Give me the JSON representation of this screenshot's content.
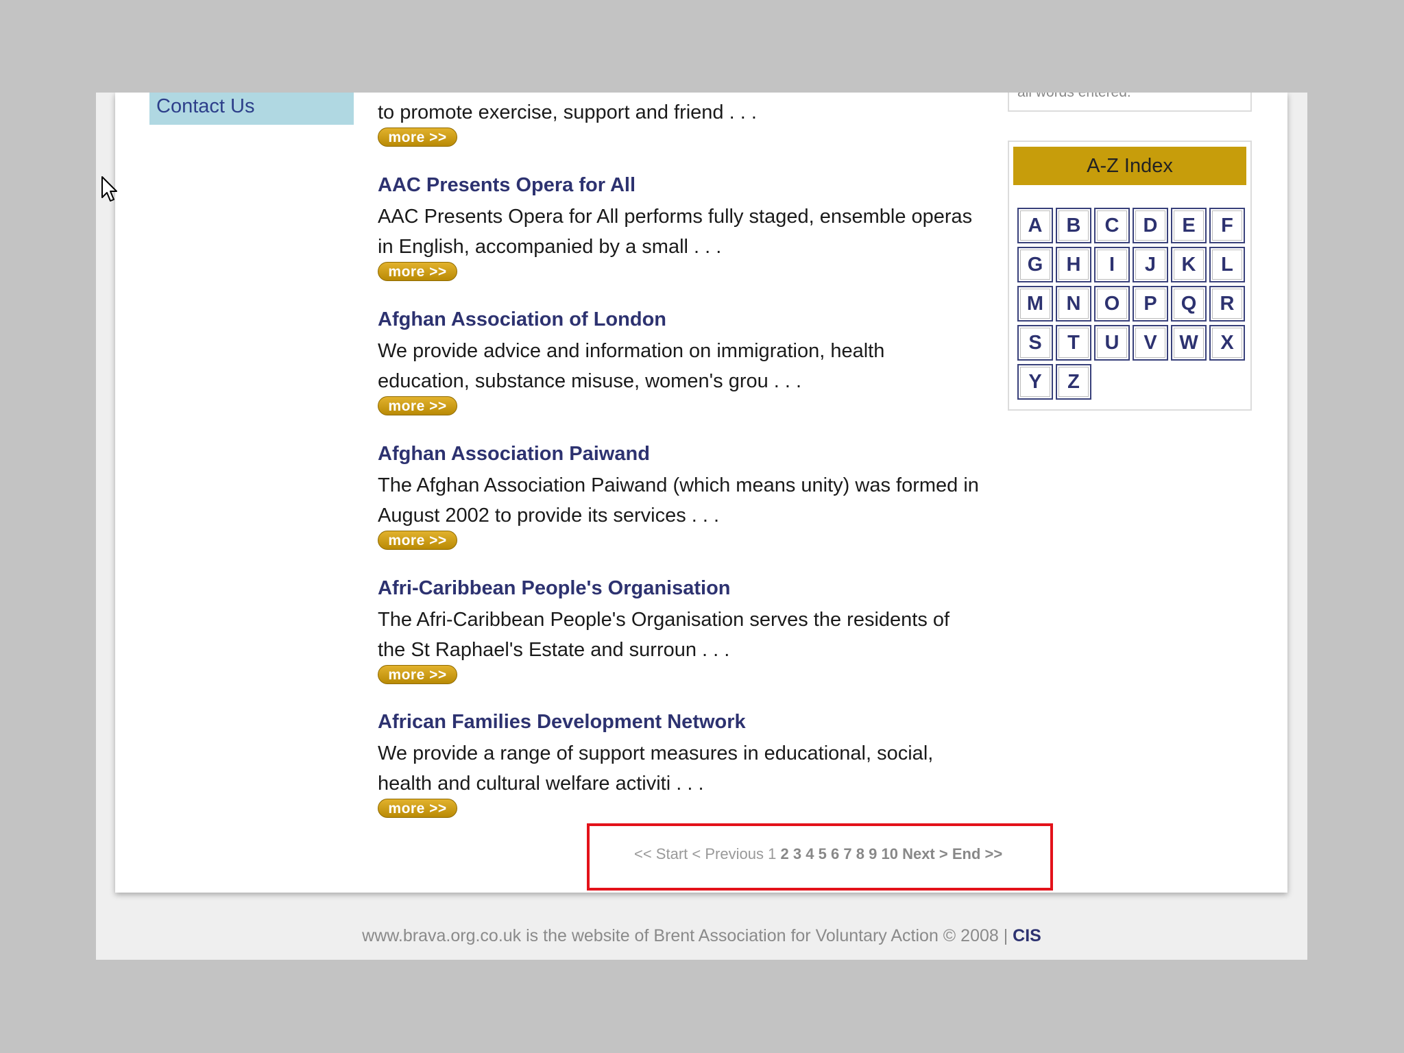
{
  "nav": {
    "contact_label": "Contact Us"
  },
  "listing": {
    "top_snippet": "to promote exercise, support and friend . . .",
    "more_label": "more >>",
    "entries": [
      {
        "title": "AAC Presents Opera for All",
        "desc": "AAC Presents Opera for All performs fully staged, ensemble operas in English, accompanied by a small . . ."
      },
      {
        "title": "Afghan Association of London",
        "desc": "We provide advice and information on immigration, health education, substance misuse, women's grou . . ."
      },
      {
        "title": "Afghan Association Paiwand",
        "desc": "The Afghan Association Paiwand (which means unity) was formed in August 2002 to provide its services . . ."
      },
      {
        "title": "Afri-Caribbean People's Organisation",
        "desc": "The Afri-Caribbean People's Organisation serves the residents of the St Raphael's Estate and surroun . . ."
      },
      {
        "title": "African Families Development Network",
        "desc": "We provide a range of support measures in educational, social, health and cultural welfare activiti . . ."
      }
    ]
  },
  "search": {
    "hint_text": "all words entered."
  },
  "az_index": {
    "title": "A-Z Index",
    "letters": [
      "A",
      "B",
      "C",
      "D",
      "E",
      "F",
      "G",
      "H",
      "I",
      "J",
      "K",
      "L",
      "M",
      "N",
      "O",
      "P",
      "Q",
      "R",
      "S",
      "T",
      "U",
      "V",
      "W",
      "X",
      "Y",
      "Z"
    ]
  },
  "pagination": {
    "start": "<< Start",
    "previous": "< Previous",
    "current": "1",
    "pages": [
      "2",
      "3",
      "4",
      "5",
      "6",
      "7",
      "8",
      "9",
      "10"
    ],
    "next": "Next >",
    "end": "End >>"
  },
  "footer": {
    "text": "www.brava.org.co.uk is the website of Brent Association for Voluntary Action © 2008 |",
    "cis_label": "CIS"
  },
  "colors": {
    "nav_bg": "#b0d8e2",
    "title_blue": "#2d3270",
    "az_header_gold": "#c79d0b",
    "highlight_red": "#e3121a",
    "page_bg": "#c3c3c3"
  }
}
